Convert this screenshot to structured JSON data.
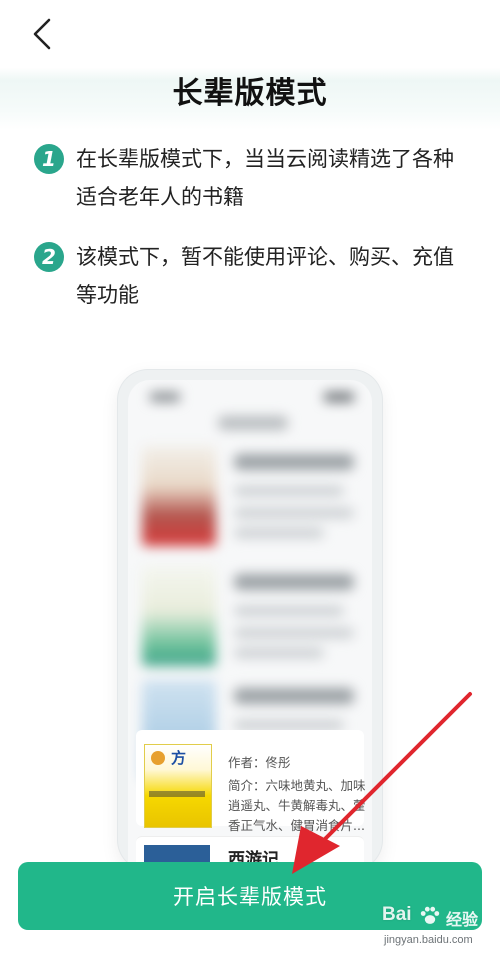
{
  "header": {
    "title": "长辈版模式"
  },
  "features": [
    {
      "number": "1",
      "text": "在长辈版模式下，当当云阅读精选了各种适合老年人的书籍"
    },
    {
      "number": "2",
      "text": "该模式下，暂不能使用评论、购买、充值等功能"
    }
  ],
  "preview": {
    "book1": {
      "cover_text": "方",
      "author": "作者：佟彤",
      "intro": "简介：六味地黄丸、加味逍遥丸、牛黄解毒丸、藿香正气水、健胃消食片..."
    },
    "book2": {
      "title": "西游记"
    }
  },
  "cta": {
    "label": "开启长辈版模式"
  },
  "watermark": {
    "brand": "Bai",
    "product": "经验",
    "url": "jingyan.baidu.com"
  },
  "colors": {
    "accent": "#21b78a",
    "badge": "#2aa68c",
    "arrow": "#e0262e"
  },
  "icons": {
    "back": "chevron-left-icon",
    "paw": "paw-icon"
  }
}
